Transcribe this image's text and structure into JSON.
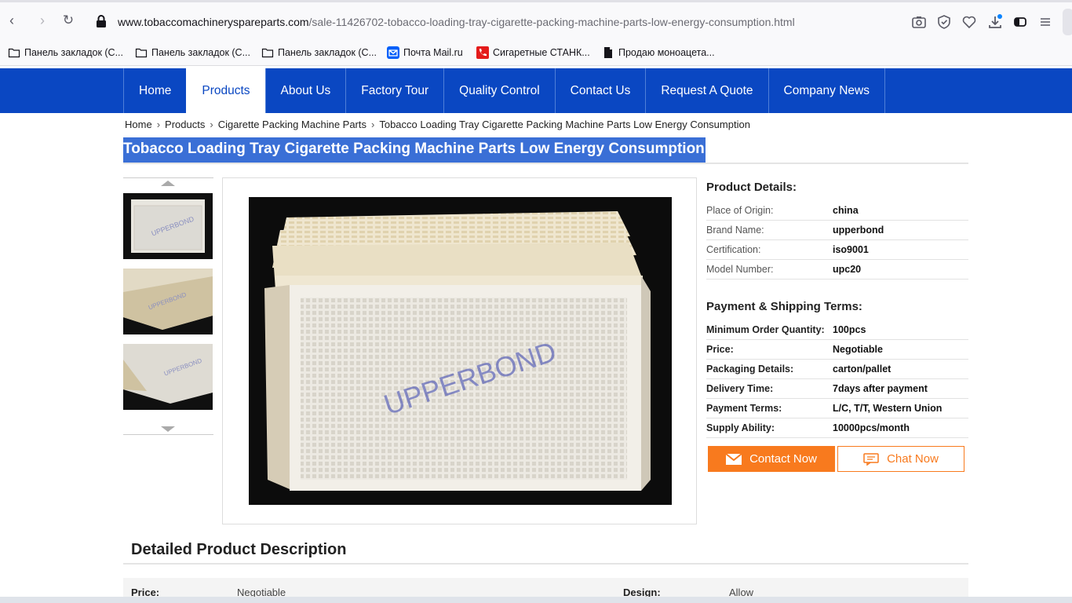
{
  "browser": {
    "url_domain": "www.tobaccomachineryspareparts.com",
    "url_path": "/sale-11426702-tobacco-loading-tray-cigarette-packing-machine-parts-low-energy-consumption.html",
    "bookmarks": [
      "Панель закладок (С...",
      "Панель закладок (С...",
      "Панель закладок (С...",
      "Почта Mail.ru",
      "Сигаретные СТАНК...",
      "Продаю моноацета..."
    ]
  },
  "nav": {
    "items": [
      "Home",
      "Products",
      "About Us",
      "Factory Tour",
      "Quality Control",
      "Contact Us",
      "Request A Quote",
      "Company News"
    ],
    "active": "Products"
  },
  "breadcrumb": [
    "Home",
    "Products",
    "Cigarette Packing Machine Parts",
    "Tobacco Loading Tray Cigarette Packing Machine Parts Low Energy Consumption"
  ],
  "page_title": "Tobacco Loading Tray Cigarette Packing Machine Parts Low Energy Consumption",
  "image": {
    "watermark": "UPPERBOND"
  },
  "product_details": {
    "title": "Product Details:",
    "rows": [
      {
        "k": "Place of Origin:",
        "v": "china"
      },
      {
        "k": "Brand Name:",
        "v": "upperbond"
      },
      {
        "k": "Certification:",
        "v": "iso9001"
      },
      {
        "k": "Model Number:",
        "v": "upc20"
      }
    ]
  },
  "payment": {
    "title": "Payment & Shipping Terms:",
    "rows": [
      {
        "k": "Minimum Order Quantity:",
        "v": "100pcs"
      },
      {
        "k": "Price:",
        "v": "Negotiable"
      },
      {
        "k": "Packaging Details:",
        "v": "carton/pallet"
      },
      {
        "k": "Delivery Time:",
        "v": "7days after payment"
      },
      {
        "k": "Payment Terms:",
        "v": "L/C, T/T, Western Union"
      },
      {
        "k": "Supply Ability:",
        "v": "10000pcs/month"
      }
    ]
  },
  "buttons": {
    "contact": "Contact Now",
    "chat": "Chat Now"
  },
  "description": {
    "title": "Detailed Product Description",
    "row": {
      "k1": "Price:",
      "v1": "Negotiable",
      "k2": "Design:",
      "v2": "Allow"
    }
  }
}
